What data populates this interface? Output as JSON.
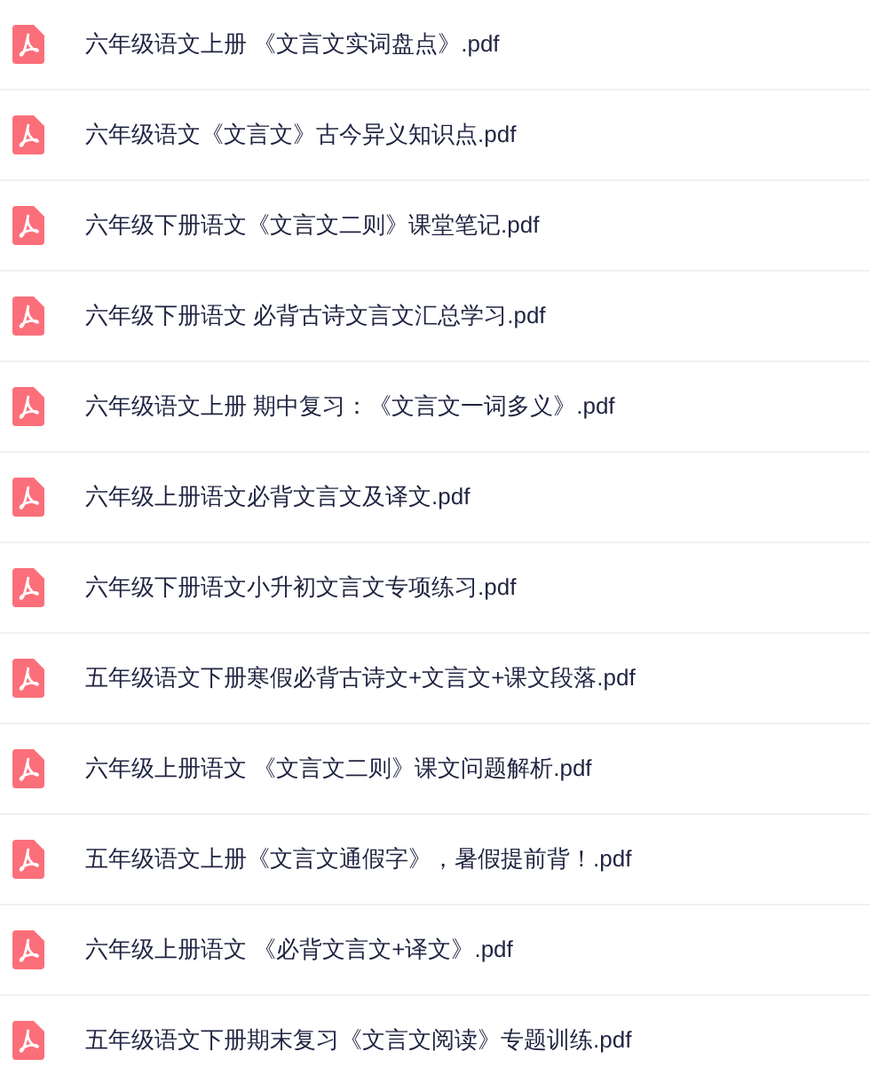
{
  "files": [
    {
      "name": "六年级语文上册 《文言文实词盘点》.pdf"
    },
    {
      "name": "六年级语文《文言文》古今异义知识点.pdf"
    },
    {
      "name": "六年级下册语文《文言文二则》课堂笔记.pdf"
    },
    {
      "name": "六年级下册语文 必背古诗文言文汇总学习.pdf"
    },
    {
      "name": "六年级语文上册 期中复习：《文言文一词多义》.pdf"
    },
    {
      "name": "六年级上册语文必背文言文及译文.pdf"
    },
    {
      "name": "六年级下册语文小升初文言文专项练习.pdf"
    },
    {
      "name": "五年级语文下册寒假必背古诗文+文言文+课文段落.pdf"
    },
    {
      "name": "六年级上册语文 《文言文二则》课文问题解析.pdf"
    },
    {
      "name": "五年级语文上册《文言文通假字》，暑假提前背！.pdf"
    },
    {
      "name": "六年级上册语文 《必背文言文+译文》.pdf"
    },
    {
      "name": "五年级语文下册期末复习《文言文阅读》专题训练.pdf"
    }
  ]
}
